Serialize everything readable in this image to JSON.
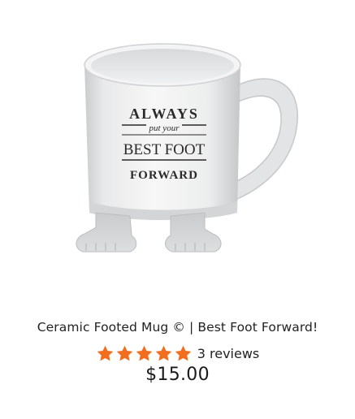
{
  "product": {
    "title": "Ceramic Footed Mug © | Best Foot Forward!",
    "image": {
      "alt_icon": "mug-product-image",
      "mug_text": [
        "ALWAYS",
        "put your",
        "BEST FOOT",
        "FORWARD"
      ]
    },
    "rating": {
      "stars": 5,
      "star_color": "#f26d1d",
      "reviews_label": "3 reviews"
    },
    "price": "$15.00"
  }
}
